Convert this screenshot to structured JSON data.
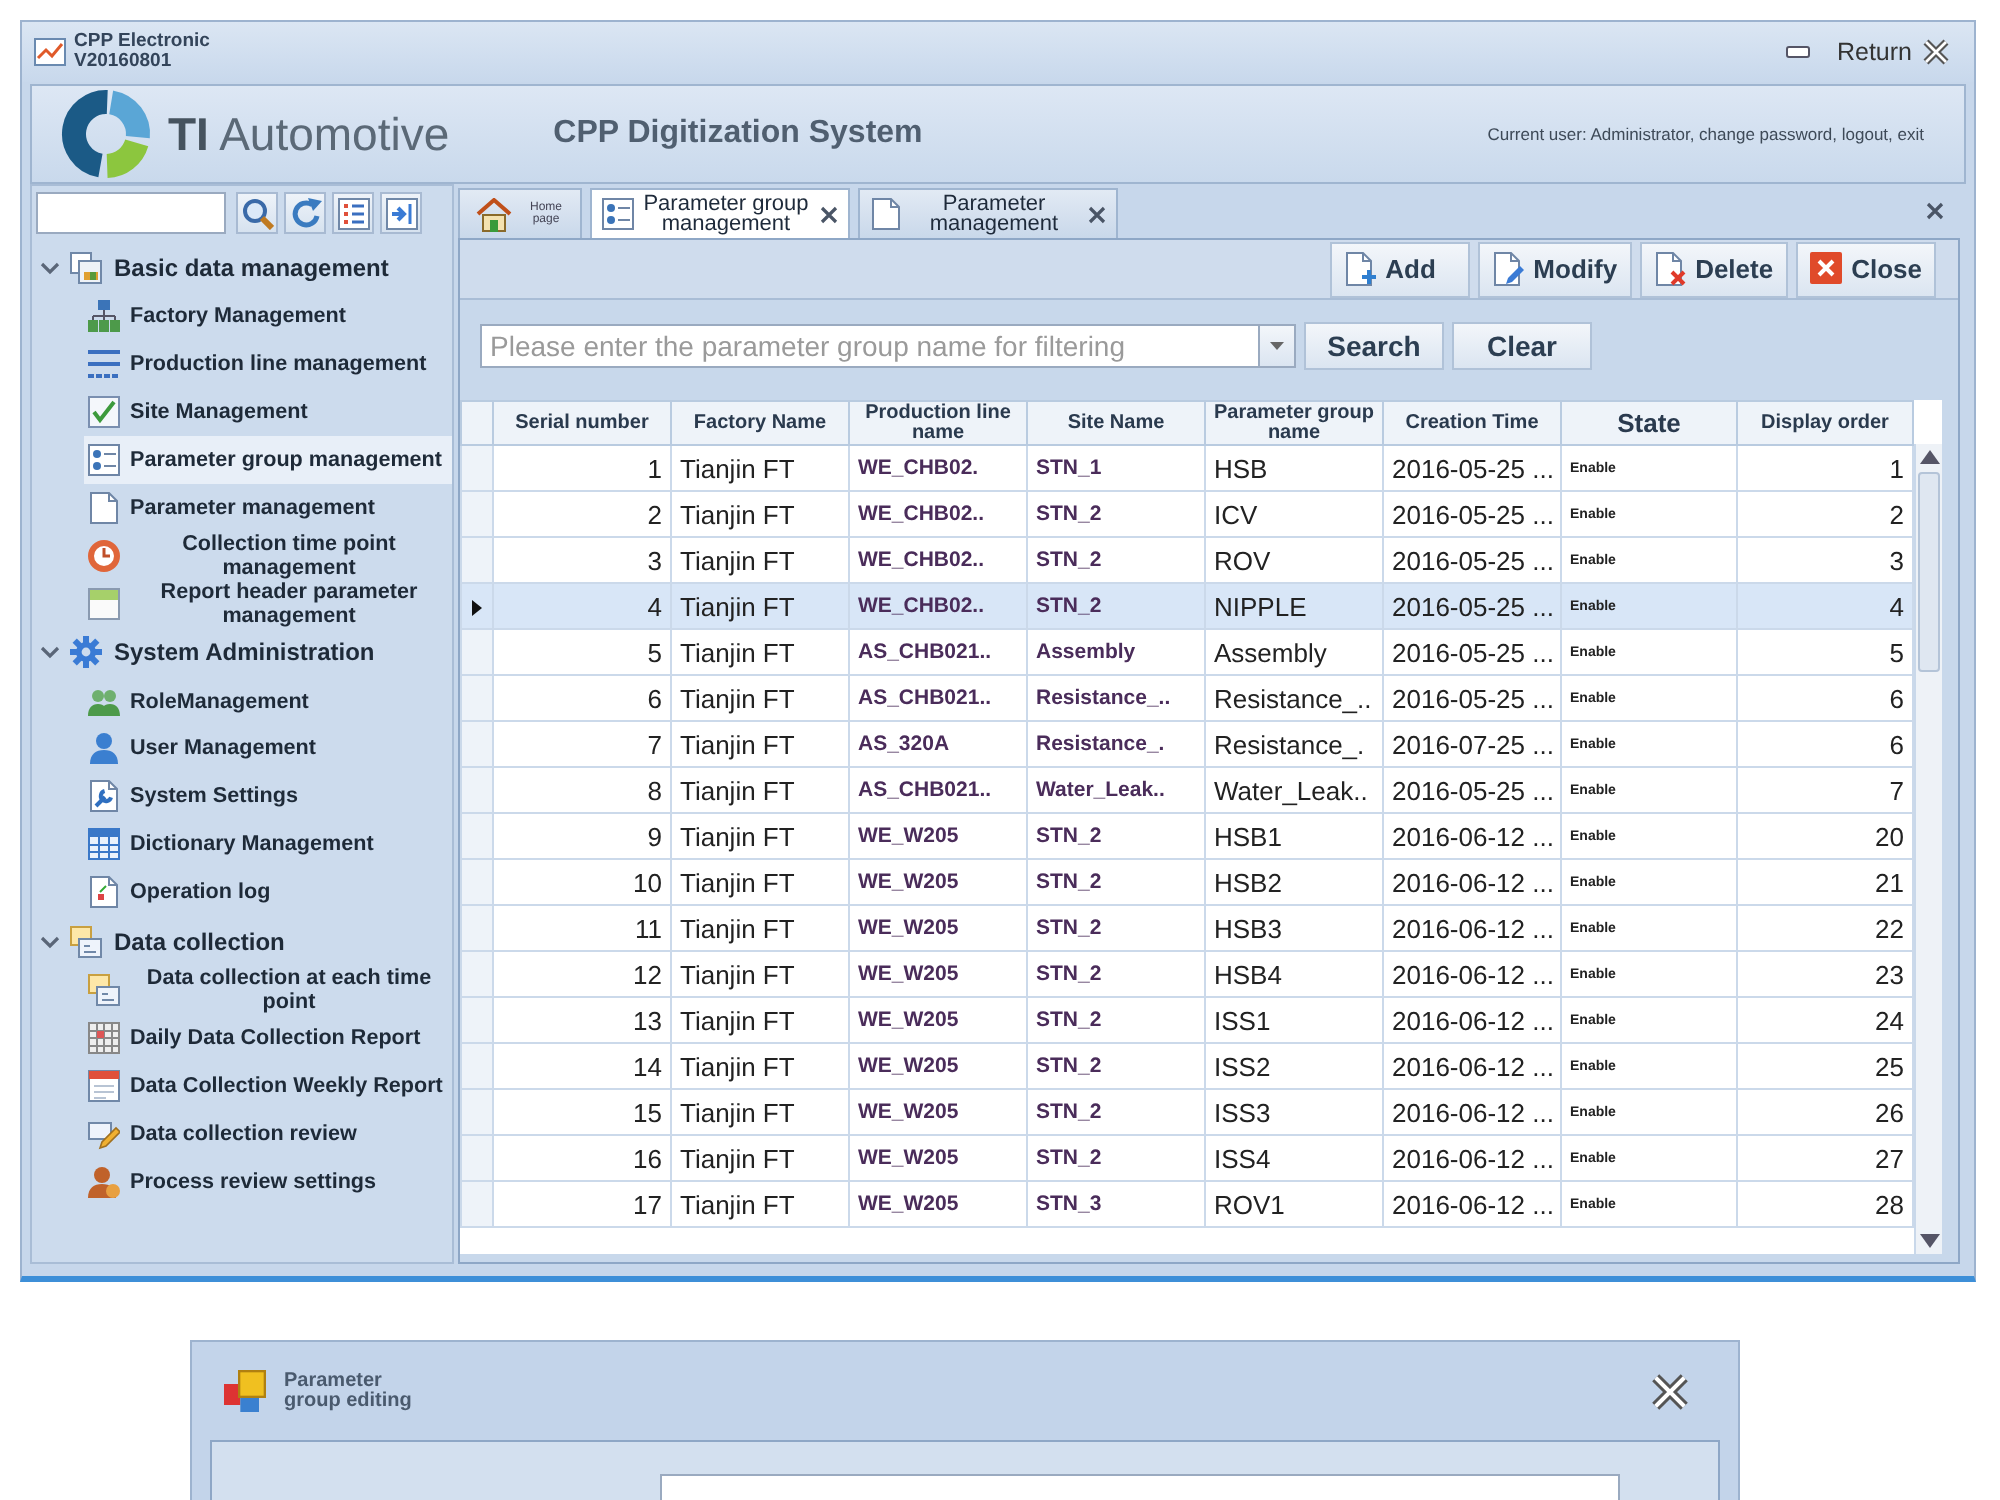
{
  "window": {
    "title": "CPP Electronic",
    "version": "V20160801",
    "return_label": "Return"
  },
  "header": {
    "brand": "**TI** Automotive",
    "system_name": "CPP Digitization System",
    "user_info": "Current user: Administrator, change password, logout, exit"
  },
  "sidebar": {
    "tree": [
      {
        "label": "Basic data management",
        "expanded": true,
        "selected": false,
        "children": [
          {
            "label": "Factory Management",
            "selected": false
          },
          {
            "label": "Production line management",
            "selected": false
          },
          {
            "label": "Site Management",
            "selected": false
          },
          {
            "label": "Parameter group management",
            "selected": true
          },
          {
            "label": "Parameter management",
            "selected": false
          },
          {
            "label": "Collection time point management",
            "selected": false
          },
          {
            "label": "Report header parameter management",
            "selected": false
          }
        ]
      },
      {
        "label": "System Administration",
        "expanded": true,
        "selected": false,
        "children": [
          {
            "label": "RoleManagement",
            "selected": false
          },
          {
            "label": "User Management",
            "selected": false
          },
          {
            "label": "System Settings",
            "selected": false
          },
          {
            "label": "Dictionary Management",
            "selected": false
          },
          {
            "label": "Operation log",
            "selected": false
          }
        ]
      },
      {
        "label": "Data collection",
        "expanded": true,
        "selected": false,
        "children": [
          {
            "label": "Data collection at each time point",
            "selected": false
          },
          {
            "label": "Daily Data Collection Report",
            "selected": false
          },
          {
            "label": "Data Collection Weekly Report",
            "selected": false
          },
          {
            "label": "Data collection review",
            "selected": false
          },
          {
            "label": "Process review settings",
            "selected": false
          }
        ]
      }
    ]
  },
  "tabs": [
    {
      "label": "Home page",
      "kind": "home",
      "selected": false,
      "closable": false
    },
    {
      "label": "Parameter group management",
      "kind": "page",
      "selected": true,
      "closable": true
    },
    {
      "label": "Parameter management",
      "kind": "page",
      "selected": false,
      "closable": true
    }
  ],
  "toolbar": {
    "buttons": [
      {
        "label": "Add",
        "kind": "add"
      },
      {
        "label": "Modify",
        "kind": "modify"
      },
      {
        "label": "Delete",
        "kind": "delete"
      },
      {
        "label": "Close",
        "kind": "close"
      }
    ]
  },
  "filter": {
    "placeholder": "Please enter the parameter group name for filtering",
    "buttons": [
      "Search",
      "Clear"
    ]
  },
  "table": {
    "columns": [
      {
        "label": "Serial number",
        "kind": "number"
      },
      {
        "label": "Factory Name",
        "kind": "text"
      },
      {
        "label": "Production line name",
        "kind": "code"
      },
      {
        "label": "Site Name",
        "kind": "code"
      },
      {
        "label": "Parameter group name",
        "kind": "text"
      },
      {
        "label": "Creation Time",
        "kind": "text"
      },
      {
        "label": "State",
        "kind": "status"
      },
      {
        "label": "Display order",
        "kind": "number"
      }
    ],
    "rows": [
      {
        "cells": [
          "1",
          "Tianjin FT",
          "WE_CHB02.",
          "STN_1",
          "HSB",
          "2016-05-25 ...",
          "Enable",
          "1"
        ],
        "selected": false
      },
      {
        "cells": [
          "2",
          "Tianjin FT",
          "WE_CHB02..",
          "STN_2",
          "ICV",
          "2016-05-25 ...",
          "Enable",
          "2"
        ],
        "selected": false
      },
      {
        "cells": [
          "3",
          "Tianjin FT",
          "WE_CHB02..",
          "STN_2",
          "ROV",
          "2016-05-25 ...",
          "Enable",
          "3"
        ],
        "selected": false
      },
      {
        "cells": [
          "4",
          "Tianjin FT",
          "WE_CHB02..",
          "STN_2",
          "NIPPLE",
          "2016-05-25 ...",
          "Enable",
          "4"
        ],
        "selected": true
      },
      {
        "cells": [
          "5",
          "Tianjin FT",
          "AS_CHB021..",
          "Assembly",
          "Assembly",
          "2016-05-25 ...",
          "Enable",
          "5"
        ],
        "selected": false
      },
      {
        "cells": [
          "6",
          "Tianjin FT",
          "AS_CHB021..",
          "Resistance_..",
          "Resistance_..",
          "2016-05-25 ...",
          "Enable",
          "6"
        ],
        "selected": false
      },
      {
        "cells": [
          "7",
          "Tianjin FT",
          "AS_320A",
          "Resistance_.",
          "Resistance_.",
          "2016-07-25 ...",
          "Enable",
          "6"
        ],
        "selected": false
      },
      {
        "cells": [
          "8",
          "Tianjin FT",
          "AS_CHB021..",
          "Water_Leak..",
          "Water_Leak..",
          "2016-05-25 ...",
          "Enable",
          "7"
        ],
        "selected": false
      },
      {
        "cells": [
          "9",
          "Tianjin FT",
          "WE_W205",
          "STN_2",
          "HSB1",
          "2016-06-12 ...",
          "Enable",
          "20"
        ],
        "selected": false
      },
      {
        "cells": [
          "10",
          "Tianjin FT",
          "WE_W205",
          "STN_2",
          "HSB2",
          "2016-06-12 ...",
          "Enable",
          "21"
        ],
        "selected": false
      },
      {
        "cells": [
          "11",
          "Tianjin FT",
          "WE_W205",
          "STN_2",
          "HSB3",
          "2016-06-12 ...",
          "Enable",
          "22"
        ],
        "selected": false
      },
      {
        "cells": [
          "12",
          "Tianjin FT",
          "WE_W205",
          "STN_2",
          "HSB4",
          "2016-06-12 ...",
          "Enable",
          "23"
        ],
        "selected": false
      },
      {
        "cells": [
          "13",
          "Tianjin FT",
          "WE_W205",
          "STN_2",
          "ISS1",
          "2016-06-12 ...",
          "Enable",
          "24"
        ],
        "selected": false
      },
      {
        "cells": [
          "14",
          "Tianjin FT",
          "WE_W205",
          "STN_2",
          "ISS2",
          "2016-06-12 ...",
          "Enable",
          "25"
        ],
        "selected": false
      },
      {
        "cells": [
          "15",
          "Tianjin FT",
          "WE_W205",
          "STN_2",
          "ISS3",
          "2016-06-12 ...",
          "Enable",
          "26"
        ],
        "selected": false
      },
      {
        "cells": [
          "16",
          "Tianjin FT",
          "WE_W205",
          "STN_2",
          "ISS4",
          "2016-06-12 ...",
          "Enable",
          "27"
        ],
        "selected": false
      },
      {
        "cells": [
          "17",
          "Tianjin FT",
          "WE_W205",
          "STN_3",
          "ROV1",
          "2016-06-12 ...",
          "Enable",
          "28"
        ],
        "selected": false
      }
    ]
  },
  "dialog": {
    "title": "Parameter group editing"
  }
}
